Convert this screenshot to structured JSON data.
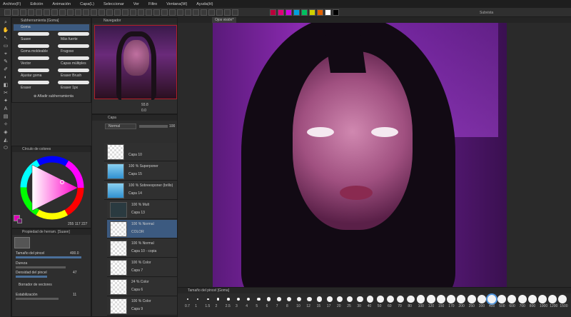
{
  "menu": [
    "Archivo(F)",
    "Edición",
    "Animación",
    "Capa(L)",
    "Seleccionar",
    "Ver",
    "Filtro",
    "Ventana(W)",
    "Ayuda(H)"
  ],
  "window_title": "Subvista",
  "colors": {
    "accent": "#4a90d9",
    "palette": [
      "#b8003a",
      "#e0007a",
      "#d000e0",
      "#00a0e0",
      "#00c060",
      "#d0d000",
      "#e06000",
      "#ffffff",
      "#000000"
    ]
  },
  "subtool": {
    "header": "Subherramienta [Goma]",
    "group": "Goma",
    "brushes": [
      [
        "Suave",
        "Más fuerte"
      ],
      [
        "Goma moldeable",
        "Frugoso"
      ],
      [
        "Vector",
        "Capas múltiples"
      ],
      [
        "Ajustar goma",
        "Eraser Brush"
      ],
      [
        "Eraser",
        "Eraser 1px"
      ]
    ],
    "add_label": "Añadir subherramienta"
  },
  "navigator": {
    "tabs": [
      "Navegador"
    ],
    "zoom": "93.8",
    "angle": "0.0"
  },
  "layers": {
    "tab": "Capa",
    "blend": "Normal",
    "opacity": "100",
    "items": [
      {
        "name": "Capa 10",
        "mode": ""
      },
      {
        "name": "Capa 15",
        "mode": "100 % Superponer"
      },
      {
        "name": "Capa 14",
        "mode": "100 % Sobreexponer (brillo)"
      },
      {
        "name": "Capa 13",
        "mode": "100 % Mult"
      },
      {
        "name": "COLOR",
        "mode": "100 % Normal"
      },
      {
        "name": "Capa 10 - copia",
        "mode": "100 % Normal"
      },
      {
        "name": "Capa 7",
        "mode": "100 % Color"
      },
      {
        "name": "Capa 6",
        "mode": "24 % Color"
      },
      {
        "name": "Capa 9",
        "mode": "100 % Color"
      }
    ]
  },
  "color_wheel": {
    "header": "Círculo de colores",
    "values": [
      "255",
      "117",
      "227"
    ]
  },
  "tool_props": {
    "header": "Propiedad de herram. [Suave]",
    "brush_size_label": "Tamaño del pincel",
    "brush_size": "400.0",
    "hardness_label": "Dureza",
    "density_label": "Densidad del pincel",
    "density": "47",
    "vector_label": "Borrador de vectores",
    "stabilization_label": "Estabilización",
    "stabilization": "11"
  },
  "canvas": {
    "tab": "Ojos visión*",
    "zoom": "93.8"
  },
  "brush_sizes": {
    "header": "Tamaño del pincel [Goma]",
    "values": [
      "0.7",
      "1",
      "1.5",
      "2",
      "2.5",
      "3",
      "4",
      "5",
      "6",
      "7",
      "8",
      "10",
      "12",
      "15",
      "17",
      "20",
      "25",
      "30",
      "40",
      "50",
      "60",
      "70",
      "80",
      "100",
      "120",
      "150",
      "170",
      "200",
      "250",
      "300",
      "400",
      "500",
      "600",
      "700",
      "800",
      "1000",
      "1200",
      "1500"
    ]
  }
}
